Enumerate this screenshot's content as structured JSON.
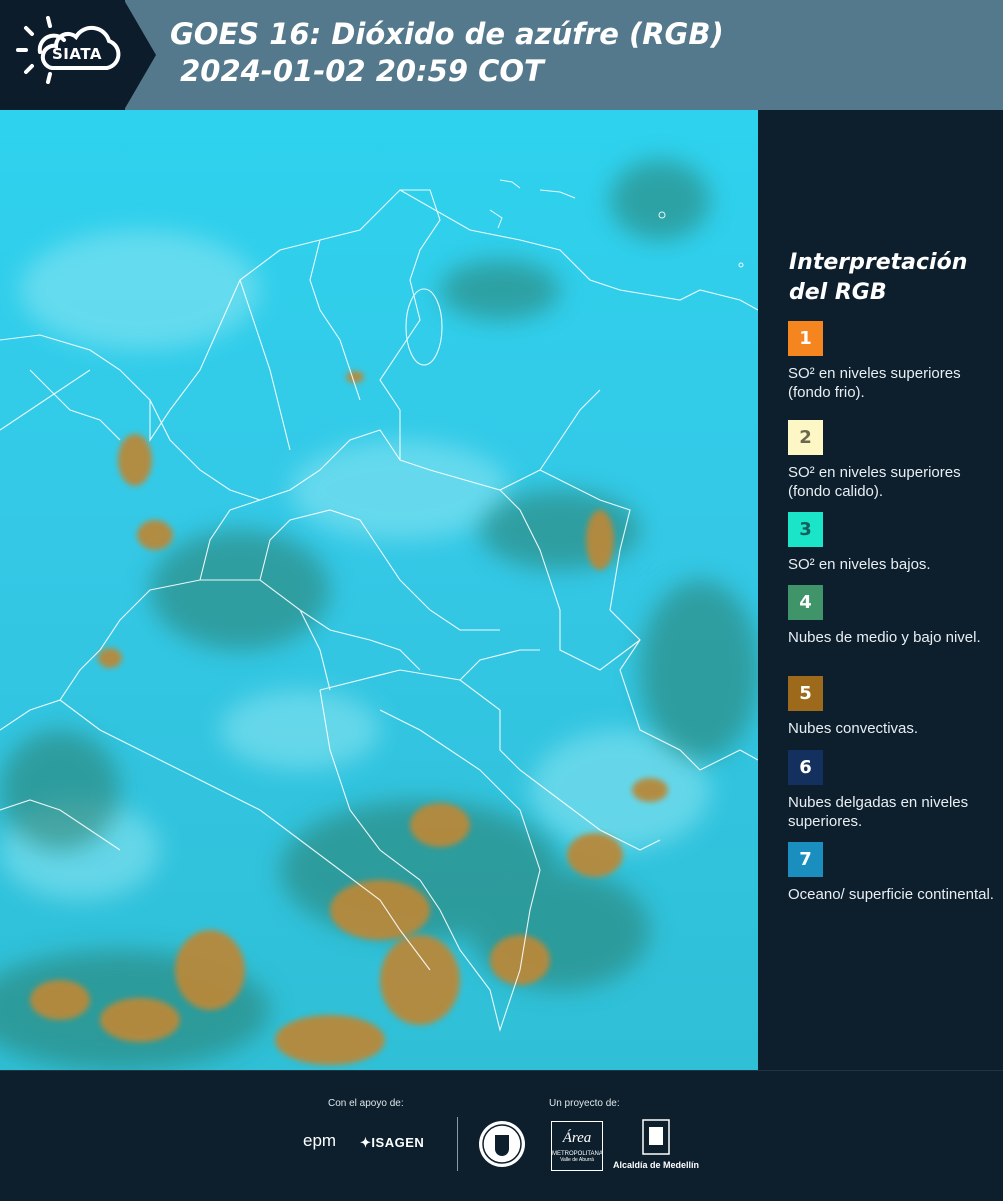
{
  "header": {
    "logo_text": "SIATA",
    "title": "GOES 16: Dióxido de azúfre (RGB)\n 2024-01-02 20:59 COT"
  },
  "legend": {
    "title": "Interpretación\ndel RGB",
    "items": [
      {
        "num": "1",
        "color": "#f4851f",
        "text_color": "#ffffff",
        "desc": "SO² en niveles superiores (fondo frio)."
      },
      {
        "num": "2",
        "color": "#fdf6c5",
        "text_color": "#6b6650",
        "desc": "SO² en niveles superiores (fondo calido)."
      },
      {
        "num": "3",
        "color": "#1be5c8",
        "text_color": "#13605a",
        "desc": "SO² en niveles bajos."
      },
      {
        "num": "4",
        "color": "#3f946a",
        "text_color": "#ffffff",
        "desc": "Nubes de medio y bajo nivel."
      },
      {
        "num": "5",
        "color": "#9c6a1a",
        "text_color": "#ffffff",
        "desc": "Nubes convectivas."
      },
      {
        "num": "6",
        "color": "#13305f",
        "text_color": "#ffffff",
        "desc": "Nubes delgadas en niveles superiores."
      },
      {
        "num": "7",
        "color": "#1a8fbf",
        "text_color": "#ffffff",
        "desc": "Oceano/ superficie continental."
      }
    ]
  },
  "footer": {
    "support_label": "Con el apoyo de:",
    "project_label": "Un proyecto de:",
    "sponsor_epm": "epm",
    "sponsor_isagen": "ISAGEN",
    "sponsor_metro_top": "Área",
    "sponsor_metro_sub": "METROPOLITANA",
    "sponsor_metro_sub2": "Valle de Aburrá",
    "sponsor_alcaldia": "Alcaldía de Medellín"
  }
}
